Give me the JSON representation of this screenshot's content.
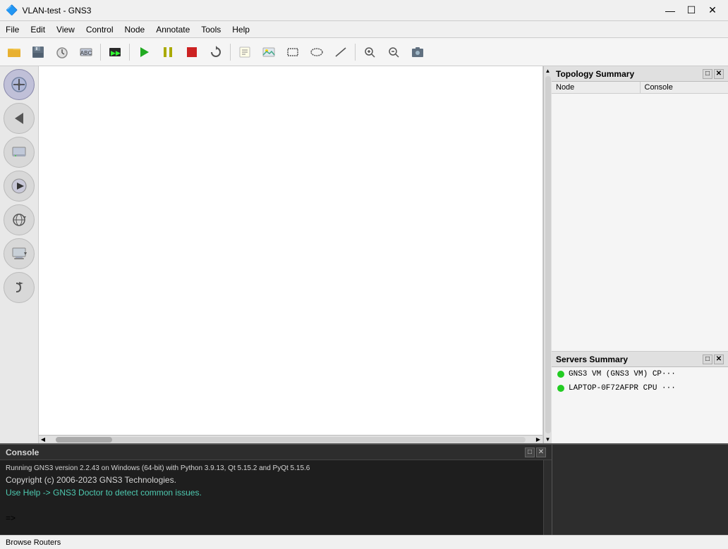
{
  "titlebar": {
    "icon": "🔷",
    "title": "VLAN-test - GNS3",
    "minimize": "—",
    "maximize": "☐",
    "close": "✕"
  },
  "menubar": {
    "items": [
      "File",
      "Edit",
      "View",
      "Control",
      "Node",
      "Annotate",
      "Tools",
      "Help"
    ]
  },
  "toolbar": {
    "buttons": [
      {
        "name": "open-folder-btn",
        "icon": "📂",
        "tooltip": "Open project"
      },
      {
        "name": "save-btn",
        "icon": "💾",
        "tooltip": "Save"
      },
      {
        "name": "timer-btn",
        "icon": "⏱",
        "tooltip": "Schedule"
      },
      {
        "name": "node-label-btn",
        "icon": "🔤",
        "tooltip": "Node labels"
      },
      {
        "name": "console-all-btn",
        "icon": "▶▶",
        "tooltip": "Console all"
      },
      {
        "name": "start-btn",
        "icon": "▶",
        "tooltip": "Start all",
        "color": "#22aa22"
      },
      {
        "name": "pause-btn",
        "icon": "⏸",
        "tooltip": "Suspend all",
        "color": "#aaaa00"
      },
      {
        "name": "stop-btn",
        "icon": "⏹",
        "tooltip": "Stop all",
        "color": "#cc2222"
      },
      {
        "name": "reload-btn",
        "icon": "↻",
        "tooltip": "Reload"
      },
      {
        "name": "notes-btn",
        "icon": "📝",
        "tooltip": "Add note"
      },
      {
        "name": "image-btn",
        "icon": "🖼",
        "tooltip": "Insert image"
      },
      {
        "name": "rect-btn",
        "icon": "▭",
        "tooltip": "Draw rectangle"
      },
      {
        "name": "ellipse-btn",
        "icon": "⬭",
        "tooltip": "Draw ellipse"
      },
      {
        "name": "line-btn",
        "icon": "╱",
        "tooltip": "Draw line"
      },
      {
        "name": "zoom-in-btn",
        "icon": "🔍+",
        "tooltip": "Zoom in"
      },
      {
        "name": "zoom-out-btn",
        "icon": "🔍-",
        "tooltip": "Zoom out"
      },
      {
        "name": "screenshot-btn",
        "icon": "📷",
        "tooltip": "Screenshot"
      }
    ]
  },
  "sidebar": {
    "buttons": [
      {
        "name": "select-tool",
        "icon": "✛",
        "tooltip": "Select/Move"
      },
      {
        "name": "back-btn",
        "icon": "←",
        "tooltip": "Back"
      },
      {
        "name": "monitor-btn",
        "icon": "🖥",
        "tooltip": "Routers"
      },
      {
        "name": "play-btn",
        "icon": "⏵",
        "tooltip": "Play"
      },
      {
        "name": "network-btn",
        "icon": "🌐",
        "tooltip": "Network"
      },
      {
        "name": "pc-btn",
        "icon": "💻",
        "tooltip": "End devices"
      },
      {
        "name": "forward-btn",
        "icon": "↪",
        "tooltip": "Forward"
      }
    ]
  },
  "topology_summary": {
    "title": "Topology Summary",
    "columns": [
      "Node",
      "Console"
    ],
    "rows": [],
    "controls": [
      "□",
      "✕"
    ]
  },
  "servers_summary": {
    "title": "Servers Summary",
    "controls": [
      "□",
      "✕"
    ],
    "items": [
      {
        "text": "GNS3 VM (GNS3 VM) CP···",
        "status": "green"
      },
      {
        "text": "LAPTOP-0F72AFPR CPU ···",
        "status": "green"
      }
    ]
  },
  "console": {
    "title": "Console",
    "controls": [
      "□",
      "✕"
    ],
    "lines": [
      {
        "text": "Running GNS3 version 2.2.43 on Windows (64-bit) with Python 3.9.13, Qt 5.15.2 and PyQt 5.15.6",
        "class": "running"
      },
      {
        "text": "Copyright (c) 2006-2023 GNS3 Technologies.",
        "class": "copyright"
      },
      {
        "text": "Use Help -> GNS3 Doctor to detect common issues.",
        "class": "help"
      },
      {
        "text": "",
        "class": "blank"
      },
      {
        "text": "=>",
        "class": "prompt"
      }
    ]
  },
  "statusbar": {
    "text": "Browse Routers"
  }
}
